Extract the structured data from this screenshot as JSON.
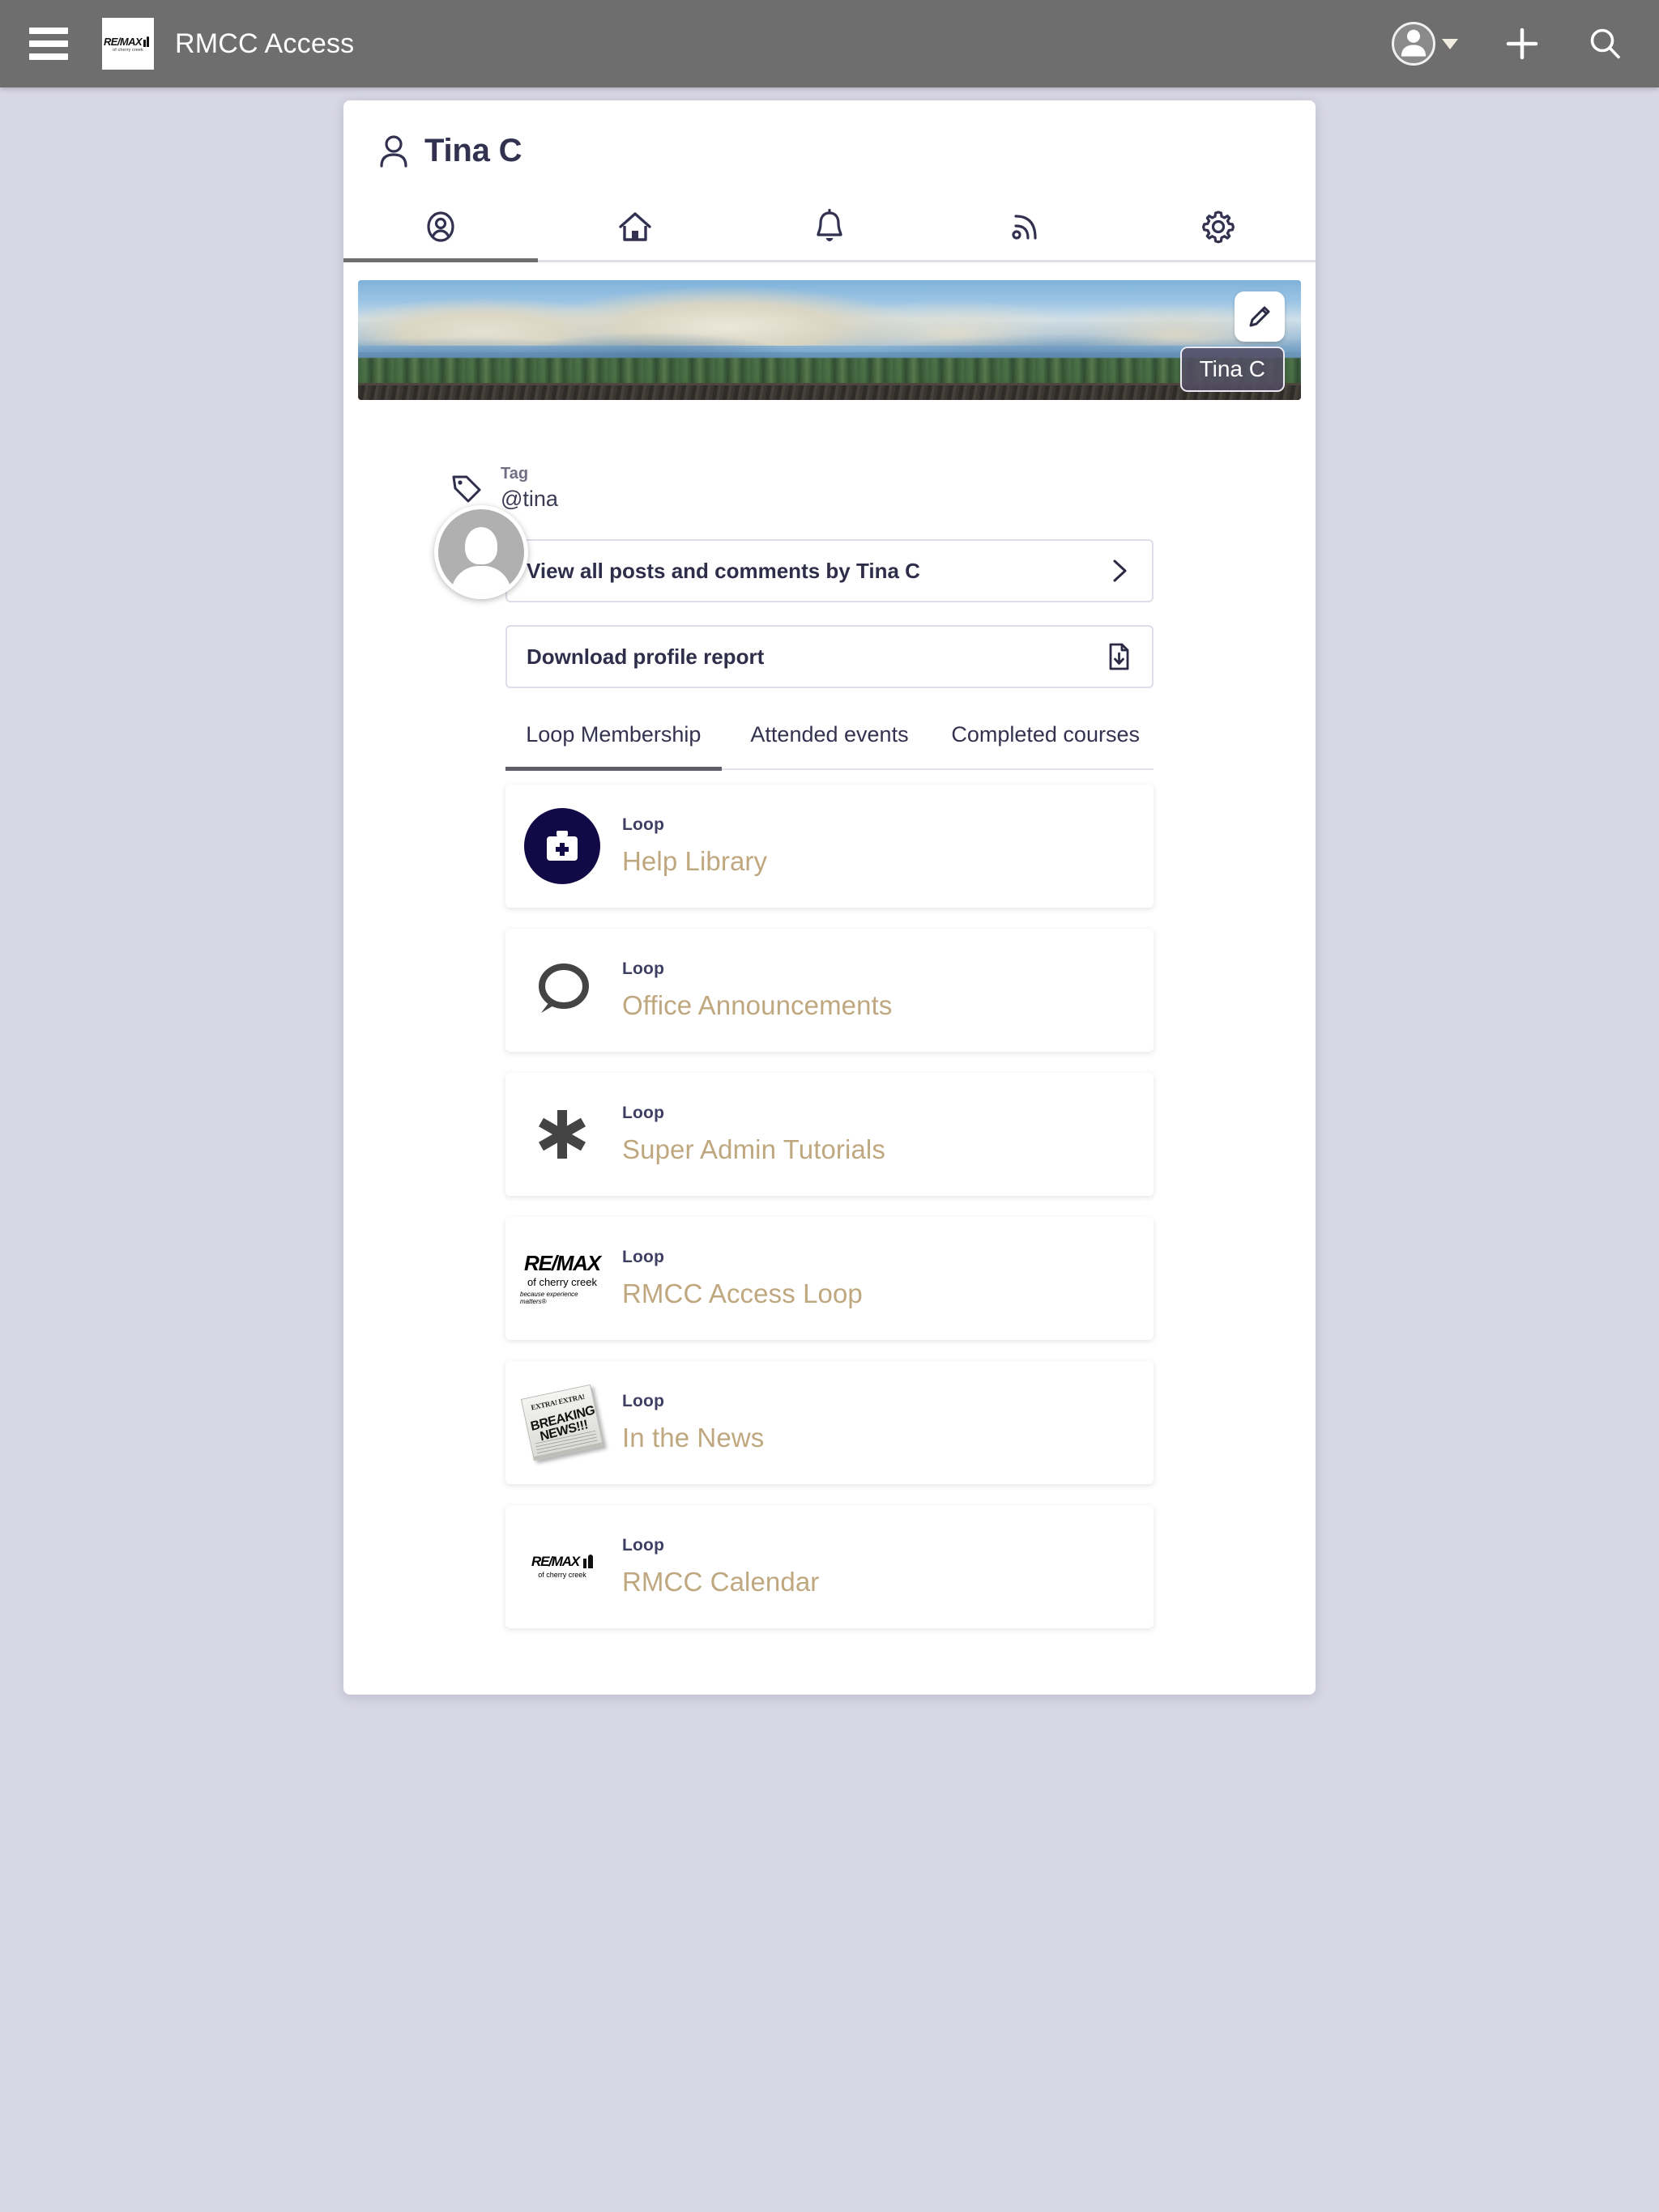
{
  "topbar": {
    "menu_icon": "hamburger-icon",
    "brand_logo": {
      "word": "RE/MAX",
      "sub": "of cherry creek"
    },
    "title": "RMCC Access",
    "avatar_icon": "user-avatar-icon",
    "caret_icon": "caret-down-icon",
    "add_icon": "plus-icon",
    "search_icon": "search-icon"
  },
  "profile": {
    "person_icon": "person-icon",
    "title": "Tina C",
    "icon_tabs": [
      {
        "name": "tab-profile",
        "icon": "user-circle-icon",
        "active": true
      },
      {
        "name": "tab-home",
        "icon": "home-icon",
        "active": false
      },
      {
        "name": "tab-notifications",
        "icon": "bell-icon",
        "active": false
      },
      {
        "name": "tab-feed",
        "icon": "rss-icon",
        "active": false
      },
      {
        "name": "tab-settings",
        "icon": "gear-icon",
        "active": false
      }
    ],
    "banner": {
      "edit_icon": "pencil-icon",
      "name_badge": "Tina C",
      "avatar_icon": "avatar-placeholder-icon"
    },
    "tag": {
      "icon": "tag-icon",
      "label": "Tag",
      "value": "@tina"
    },
    "actions": [
      {
        "label": "View all posts and comments by Tina C",
        "icon": "chevron-right-icon",
        "name": "view-all-posts-button"
      },
      {
        "label": "Download profile report",
        "icon": "file-download-icon",
        "name": "download-profile-report-button"
      }
    ],
    "content_tabs": [
      {
        "label": "Loop Membership",
        "active": true
      },
      {
        "label": "Attended events",
        "active": false
      },
      {
        "label": "Completed courses",
        "active": false
      }
    ],
    "loops": [
      {
        "kind": "Loop",
        "name": "Help Library",
        "icon": "first-aid-kit-icon"
      },
      {
        "kind": "Loop",
        "name": "Office Announcements",
        "icon": "speech-bubble-icon"
      },
      {
        "kind": "Loop",
        "name": "Super Admin Tutorials",
        "icon": "asterisk-icon"
      },
      {
        "kind": "Loop",
        "name": "RMCC Access Loop",
        "icon": "remax-cherry-creek-logo-icon"
      },
      {
        "kind": "Loop",
        "name": "In the News",
        "icon": "newspaper-icon"
      },
      {
        "kind": "Loop",
        "name": "RMCC Calendar",
        "icon": "remax-balloon-logo-icon"
      }
    ]
  },
  "colors": {
    "topbar_bg": "#6e6e6e",
    "page_bg": "#d8d7e4",
    "panel_bg": "#ffffff",
    "title_text": "#323150",
    "loop_name": "#bfa87f",
    "loop_kind": "#3f3e63",
    "accent_navy": "#120a47"
  },
  "news_icon_text": {
    "line1": "EXTRA! EXTRA!",
    "line2": "BREAKING NEWS!!!"
  }
}
